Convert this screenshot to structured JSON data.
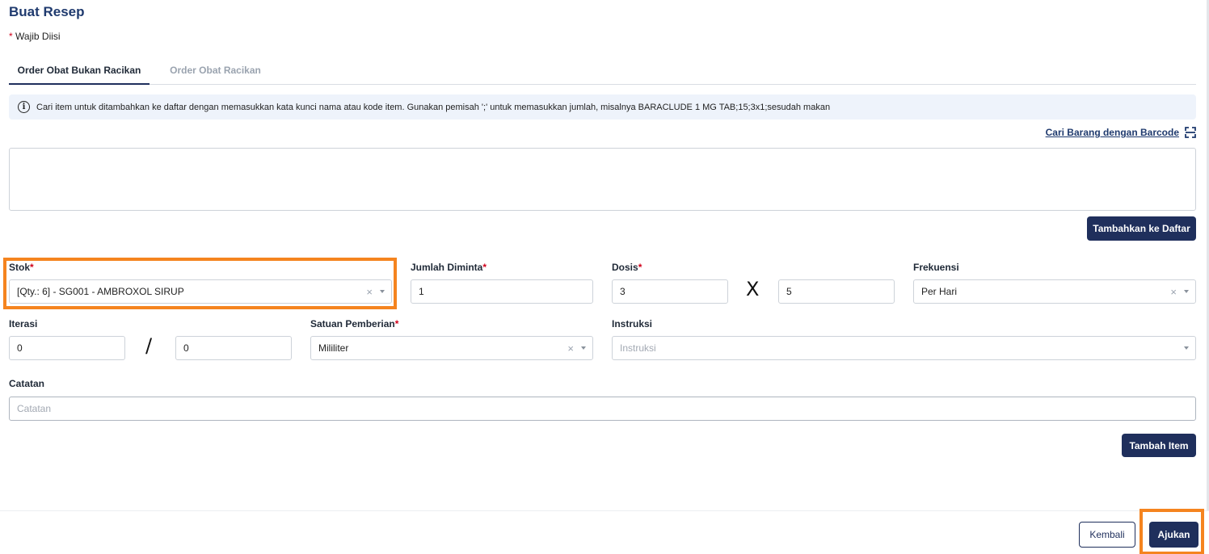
{
  "page": {
    "title": "Buat Resep",
    "required_star": "*",
    "required_note": "Wajib Diisi"
  },
  "tabs": [
    {
      "label": "Order Obat Bukan Racikan",
      "active": true
    },
    {
      "label": "Order Obat Racikan",
      "active": false
    }
  ],
  "info": {
    "icon": "info-icon",
    "text": "Cari item untuk ditambahkan ke daftar dengan memasukkan kata kunci nama atau kode item. Gunakan pemisah ';' untuk memasukkan jumlah, misalnya BARACLUDE 1 MG TAB;15;3x1;sesudah makan"
  },
  "barcode": {
    "label": "Cari Barang dengan Barcode",
    "icon": "barcode-scan-icon"
  },
  "search_area": {
    "value": ""
  },
  "add_to_list_button": "Tambahkan ke Daftar",
  "form": {
    "stok": {
      "label": "Stok",
      "value": "[Qty.: 6] - SG001 - AMBROXOL SIRUP"
    },
    "jumlah_diminta": {
      "label": "Jumlah Diminta",
      "value": "1"
    },
    "dosis": {
      "label": "Dosis",
      "value_1": "3",
      "operator": "X",
      "value_2": "5"
    },
    "frekuensi": {
      "label": "Frekuensi",
      "value": "Per Hari"
    },
    "iterasi": {
      "label": "Iterasi",
      "value_1": "0",
      "separator": "/",
      "value_2": "0"
    },
    "satuan_pemberian": {
      "label": "Satuan Pemberian",
      "value": "Mililiter"
    },
    "instruksi": {
      "label": "Instruksi",
      "placeholder": "Instruksi"
    },
    "catatan": {
      "label": "Catatan",
      "placeholder": "Catatan"
    },
    "clear_symbol": "×"
  },
  "add_item_button": "Tambah Item",
  "footer": {
    "back_button": "Kembali",
    "submit_button": "Ajukan"
  },
  "colors": {
    "primary": "#1f2f5c",
    "highlight": "#f5841f",
    "required": "#d0021b",
    "info_bg": "#eef3fb"
  }
}
